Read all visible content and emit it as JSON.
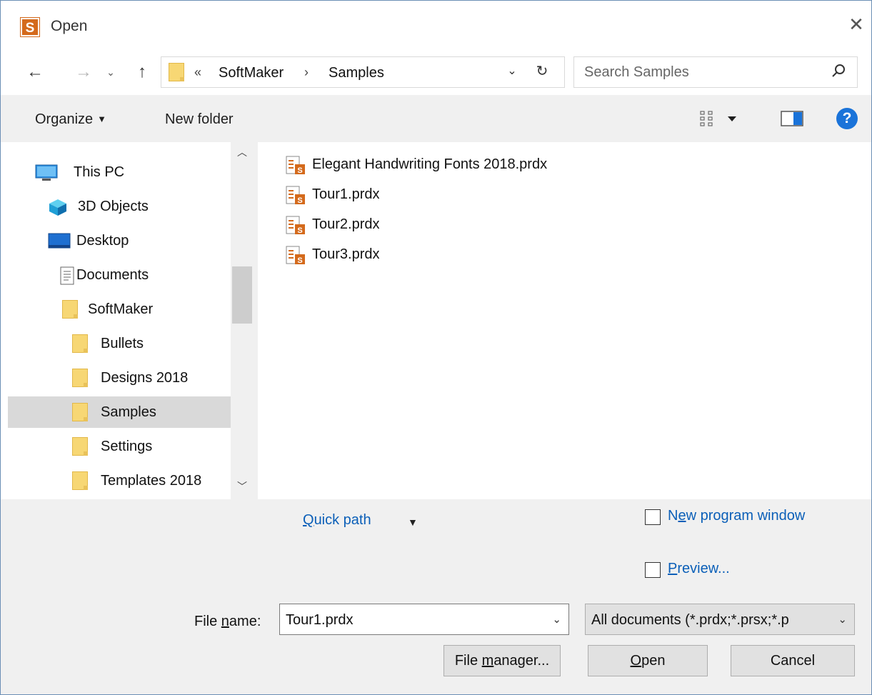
{
  "window": {
    "title": "Open",
    "app_icon_letter": "S"
  },
  "navigation": {
    "back_glyph": "←",
    "forward_glyph": "→",
    "recent_glyph": "⌄",
    "up_glyph": "↑",
    "address": {
      "overflow": "«",
      "crumbs": [
        "SoftMaker",
        "Samples"
      ],
      "separator": "›"
    },
    "search_placeholder": "Search Samples"
  },
  "toolbar": {
    "organize_label": "Organize",
    "new_folder_label": "New folder",
    "help_label": "?"
  },
  "nav_tree": {
    "items": [
      {
        "label": "This PC",
        "icon": "computer-icon",
        "indent": 0
      },
      {
        "label": "3D Objects",
        "icon": "cube-3d-icon",
        "indent": 1
      },
      {
        "label": "Desktop",
        "icon": "desktop-icon",
        "indent": 1
      },
      {
        "label": "Documents",
        "icon": "documents-icon",
        "indent": 1
      },
      {
        "label": "SoftMaker",
        "icon": "folder-icon",
        "indent": 2
      },
      {
        "label": "Bullets",
        "icon": "folder-icon",
        "indent": 3
      },
      {
        "label": "Designs 2018",
        "icon": "folder-icon",
        "indent": 3
      },
      {
        "label": "Samples",
        "icon": "folder-icon",
        "indent": 3,
        "selected": true
      },
      {
        "label": "Settings",
        "icon": "folder-icon",
        "indent": 3
      },
      {
        "label": "Templates 2018",
        "icon": "folder-icon",
        "indent": 3
      }
    ]
  },
  "files": [
    {
      "name": "Elegant Handwriting Fonts 2018.prdx",
      "icon": "prdx-file-icon"
    },
    {
      "name": "Tour1.prdx",
      "icon": "prdx-file-icon"
    },
    {
      "name": "Tour2.prdx",
      "icon": "prdx-file-icon"
    },
    {
      "name": "Tour3.prdx",
      "icon": "prdx-file-icon"
    }
  ],
  "options": {
    "quick_path_label": "Quick path",
    "new_window_label": "New program window",
    "new_window_checked": false,
    "preview_label": "Preview...",
    "preview_checked": false
  },
  "file_name": {
    "label": "File name:",
    "value": "Tour1.prdx"
  },
  "file_type": {
    "selected": "All documents (*.prdx;*.prsx;*.p"
  },
  "buttons": {
    "file_manager": "File manager...",
    "open": "Open",
    "cancel": "Cancel"
  },
  "colors": {
    "accent_link": "#0b5fb8",
    "selection": "#d9d9d9",
    "app_icon": "#d46a1c",
    "folder": "#f7d774",
    "help": "#1a73d9"
  }
}
